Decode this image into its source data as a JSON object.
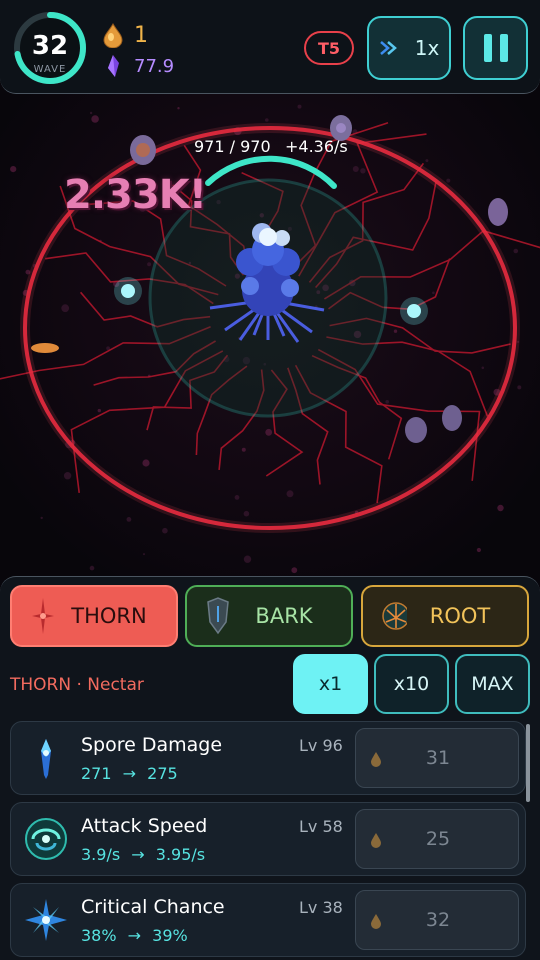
{
  "hud": {
    "wave": {
      "number": "32",
      "label": "WAVE",
      "progress": 0.72
    },
    "nectar": {
      "value": "1",
      "icon": "nectar-drop-icon"
    },
    "shards": {
      "value": "77.9",
      "icon": "crystal-shard-icon"
    },
    "tier_badge": "T5",
    "speed_button": {
      "label": "1x",
      "icon": "fast-forward-icon"
    },
    "pause_button": {
      "icon": "pause-icon"
    }
  },
  "arena": {
    "core_hp": "971 / 970",
    "regen": "+4.36/s",
    "damage_popup": "2.33K!",
    "colors": {
      "range_ring": "#e3263a",
      "core_ring": "#2fd6c0",
      "cracks": "#c2182e"
    }
  },
  "tabs": [
    {
      "label": "THORN",
      "icon": "thorn-icon",
      "selected": true
    },
    {
      "label": "BARK",
      "icon": "bark-shield-icon",
      "selected": false
    },
    {
      "label": "ROOT",
      "icon": "root-icon",
      "selected": false
    }
  ],
  "section_label": "THORN · Nectar",
  "multipliers": [
    {
      "label": "x1",
      "selected": true
    },
    {
      "label": "x10",
      "selected": false
    },
    {
      "label": "MAX",
      "selected": false
    }
  ],
  "upgrades": [
    {
      "name": "Spore Damage",
      "level": "Lv 96",
      "from": "271",
      "arrow": "→",
      "to": "275",
      "cost": "31",
      "icon": "spore-crystal-icon"
    },
    {
      "name": "Attack Speed",
      "level": "Lv 58",
      "from": "3.9/s",
      "arrow": "→",
      "to": "3.95/s",
      "cost": "25",
      "icon": "swirl-icon"
    },
    {
      "name": "Critical Chance",
      "level": "Lv 38",
      "from": "38%",
      "arrow": "→",
      "to": "39%",
      "cost": "32",
      "icon": "starburst-icon"
    }
  ]
}
